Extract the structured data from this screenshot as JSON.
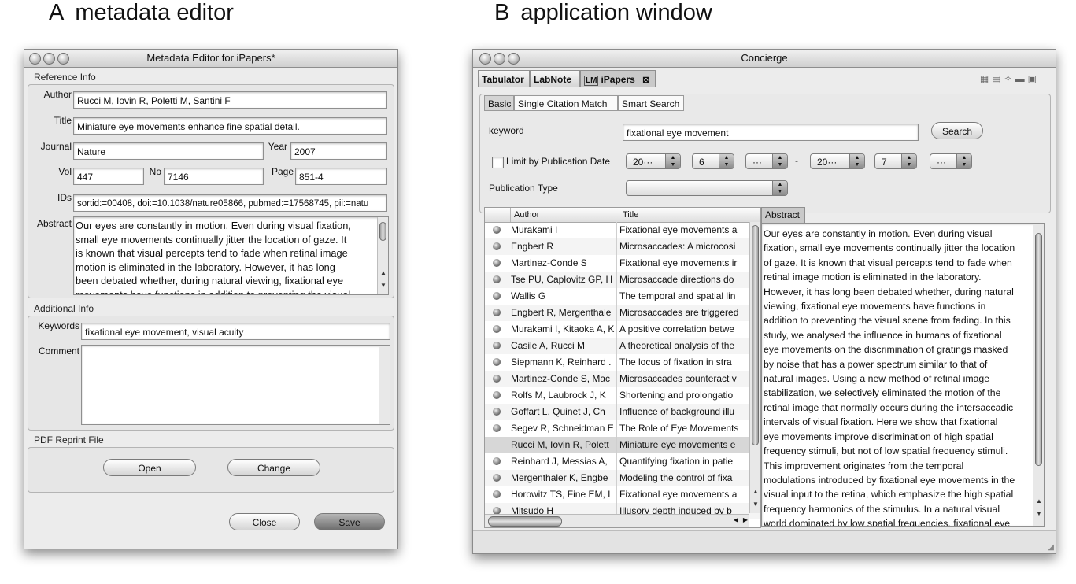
{
  "panels": {
    "a_letter": "A",
    "a_title": "metadata editor",
    "b_letter": "B",
    "b_title": "application window"
  },
  "editor": {
    "window_title": "Metadata Editor for iPapers*",
    "reference_section": "Reference Info",
    "author_label": "Author",
    "author_value": "Rucci M, Iovin R, Poletti M, Santini F",
    "title_label": "Title",
    "title_value": "Miniature eye movements enhance fine spatial detail.",
    "journal_label": "Journal",
    "journal_value": "Nature",
    "year_label": "Year",
    "year_value": "2007",
    "vol_label": "Vol",
    "vol_value": "447",
    "no_label": "No",
    "no_value": "7146",
    "page_label": "Page",
    "page_value": "851-4",
    "ids_label": "IDs",
    "ids_value": "sortid:=00408, doi:=10.1038/nature05866, pubmed:=17568745, pii:=natu",
    "abstract_label": "Abstract",
    "abstract_lines": [
      "Our eyes are constantly in motion. Even during visual fixation,",
      "small eye movements continually jitter the location of gaze. It",
      "is known that visual percepts tend to fade when retinal image",
      "motion is eliminated in the laboratory. However, it has long",
      "been debated whether, during natural viewing, fixational eye",
      "movements have functions in addition to preventing the visual"
    ],
    "additional_section": "Additional Info",
    "keywords_label": "Keywords",
    "keywords_value": "fixational eye movement, visual acuity",
    "comment_label": "Comment",
    "pdf_section": "PDF Reprint File",
    "open_button": "Open",
    "change_button": "Change",
    "close_button": "Close",
    "save_button": "Save"
  },
  "app": {
    "window_title": "Concierge",
    "tabs": [
      "Tabulator",
      "LabNote",
      "iPapers"
    ],
    "ipapers_logo": "LM",
    "subtabs": [
      "Basic",
      "Single Citation Match",
      "Smart Search"
    ],
    "keyword_label": "keyword",
    "keyword_value": "fixational eye movement",
    "search_button": "Search",
    "limit_label": "Limit by Publication Date",
    "date_from_year": "20···",
    "date_from_month": "6",
    "date_from_day": "···",
    "date_dash": "-",
    "date_to_year": "20···",
    "date_to_month": "7",
    "date_to_day": "···",
    "pubtype_label": "Publication Type",
    "col_author": "Author",
    "col_title": "Title",
    "abstract_tab": "Abstract",
    "rows": [
      {
        "author": "Murakami I",
        "title": "Fixational eye movements a"
      },
      {
        "author": "Engbert R",
        "title": "Microsaccades: A microcosi"
      },
      {
        "author": "Martinez-Conde S",
        "title": "Fixational eye movements ir"
      },
      {
        "author": "Tse PU, Caplovitz GP, H",
        "title": "Microsaccade directions do"
      },
      {
        "author": "Wallis G",
        "title": "The temporal and spatial lin"
      },
      {
        "author": "Engbert R, Mergenthale",
        "title": "Microsaccades are triggered"
      },
      {
        "author": "Murakami I, Kitaoka A, K",
        "title": "A positive correlation betwe"
      },
      {
        "author": "Casile A, Rucci M",
        "title": "A theoretical analysis of the"
      },
      {
        "author": "Siepmann K, Reinhard .",
        "title": "The locus of fixation in stra"
      },
      {
        "author": "Martinez-Conde S, Mac",
        "title": "Microsaccades counteract v"
      },
      {
        "author": "Rolfs M, Laubrock J, K",
        "title": "Shortening and prolongatio"
      },
      {
        "author": "Goffart L, Quinet J, Ch",
        "title": "Influence of background illu"
      },
      {
        "author": "Segev R, Schneidman E",
        "title": "The Role of Eye Movements"
      },
      {
        "author": "Rucci M, Iovin R, Polett",
        "title": "Miniature eye movements e"
      },
      {
        "author": "Reinhard J, Messias A,",
        "title": "Quantifying fixation in patie"
      },
      {
        "author": "Mergenthaler K, Engbe",
        "title": "Modeling the control of fixa"
      },
      {
        "author": "Horowitz TS, Fine EM, I",
        "title": "Fixational eye movements a"
      },
      {
        "author": "Mitsudo H",
        "title": "Illusory depth induced by b"
      }
    ],
    "abstract_lines": [
      "Our eyes are constantly in motion. Even during visual",
      "fixation, small eye movements continually jitter the location",
      "of gaze. It is known that visual percepts tend to fade when",
      "retinal image motion is eliminated in the laboratory.",
      "However, it has long been debated whether, during natural",
      "viewing, fixational eye movements have functions in",
      "addition to preventing the visual scene from fading. In this",
      "study, we analysed the influence in humans of fixational",
      "eye movements on the discrimination of gratings masked",
      "by noise that has a power spectrum similar to that of",
      "natural images. Using a new method of retinal image",
      "stabilization, we selectively eliminated the motion of the",
      "retinal image that normally occurs during the intersaccadic",
      "intervals of visual fixation. Here we show that fixational",
      "eye movements improve discrimination of high spatial",
      "frequency stimuli, but not of low spatial frequency stimuli.",
      "This improvement originates from the temporal",
      "modulations introduced by fixational eye movements in the",
      "visual input to the retina, which emphasize the high spatial",
      "frequency harmonics of the stimulus. In a natural visual",
      "world dominated by low spatial frequencies, fixational eye"
    ]
  }
}
